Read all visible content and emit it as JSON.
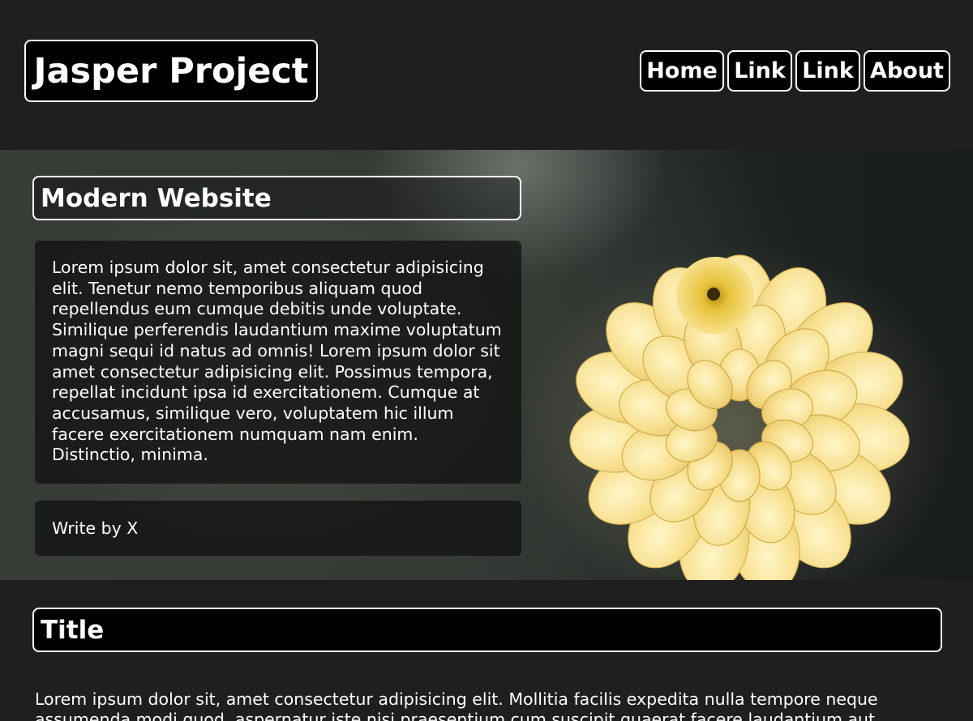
{
  "header": {
    "brand": "Jasper Project",
    "nav": [
      {
        "label": "Home"
      },
      {
        "label": "Link"
      },
      {
        "label": "Link"
      },
      {
        "label": "About"
      }
    ]
  },
  "hero": {
    "title": "Modern Website",
    "text": "Lorem ipsum dolor sit, amet consectetur adipisicing elit. Tenetur nemo temporibus aliquam quod repellendus eum cumque debitis unde voluptate. Similique perferendis laudantium maxime voluptatum magni sequi id natus ad omnis! Lorem ipsum dolor sit amet consectetur adipisicing elit. Possimus tempora, repellat incidunt ipsa id exercitationem. Cumque at accusamus, similique vero, voluptatem hic illum facere exercitationem numquam nam enim. Distinctio, minima.",
    "author": "Write by X",
    "image_icon": "yellow-dahlia-flower"
  },
  "section": {
    "title": "Title",
    "text": "Lorem ipsum dolor sit, amet consectetur adipisicing elit. Mollitia facilis expedita nulla tempore neque assumenda modi quod, aspernatur iste nisi praesentium cum suscipit quaerat facere laudantium aut quibusdam molestias? Nulla. Lorem ipsum dolor sit amet consectetur adipisicing elit. Incidunt magnam"
  },
  "colors": {
    "page_background": "#1f1f1f",
    "panel_background": "#000000",
    "border": "#ffffff",
    "text": "#ffffff",
    "flower": "#f5dc8a"
  }
}
